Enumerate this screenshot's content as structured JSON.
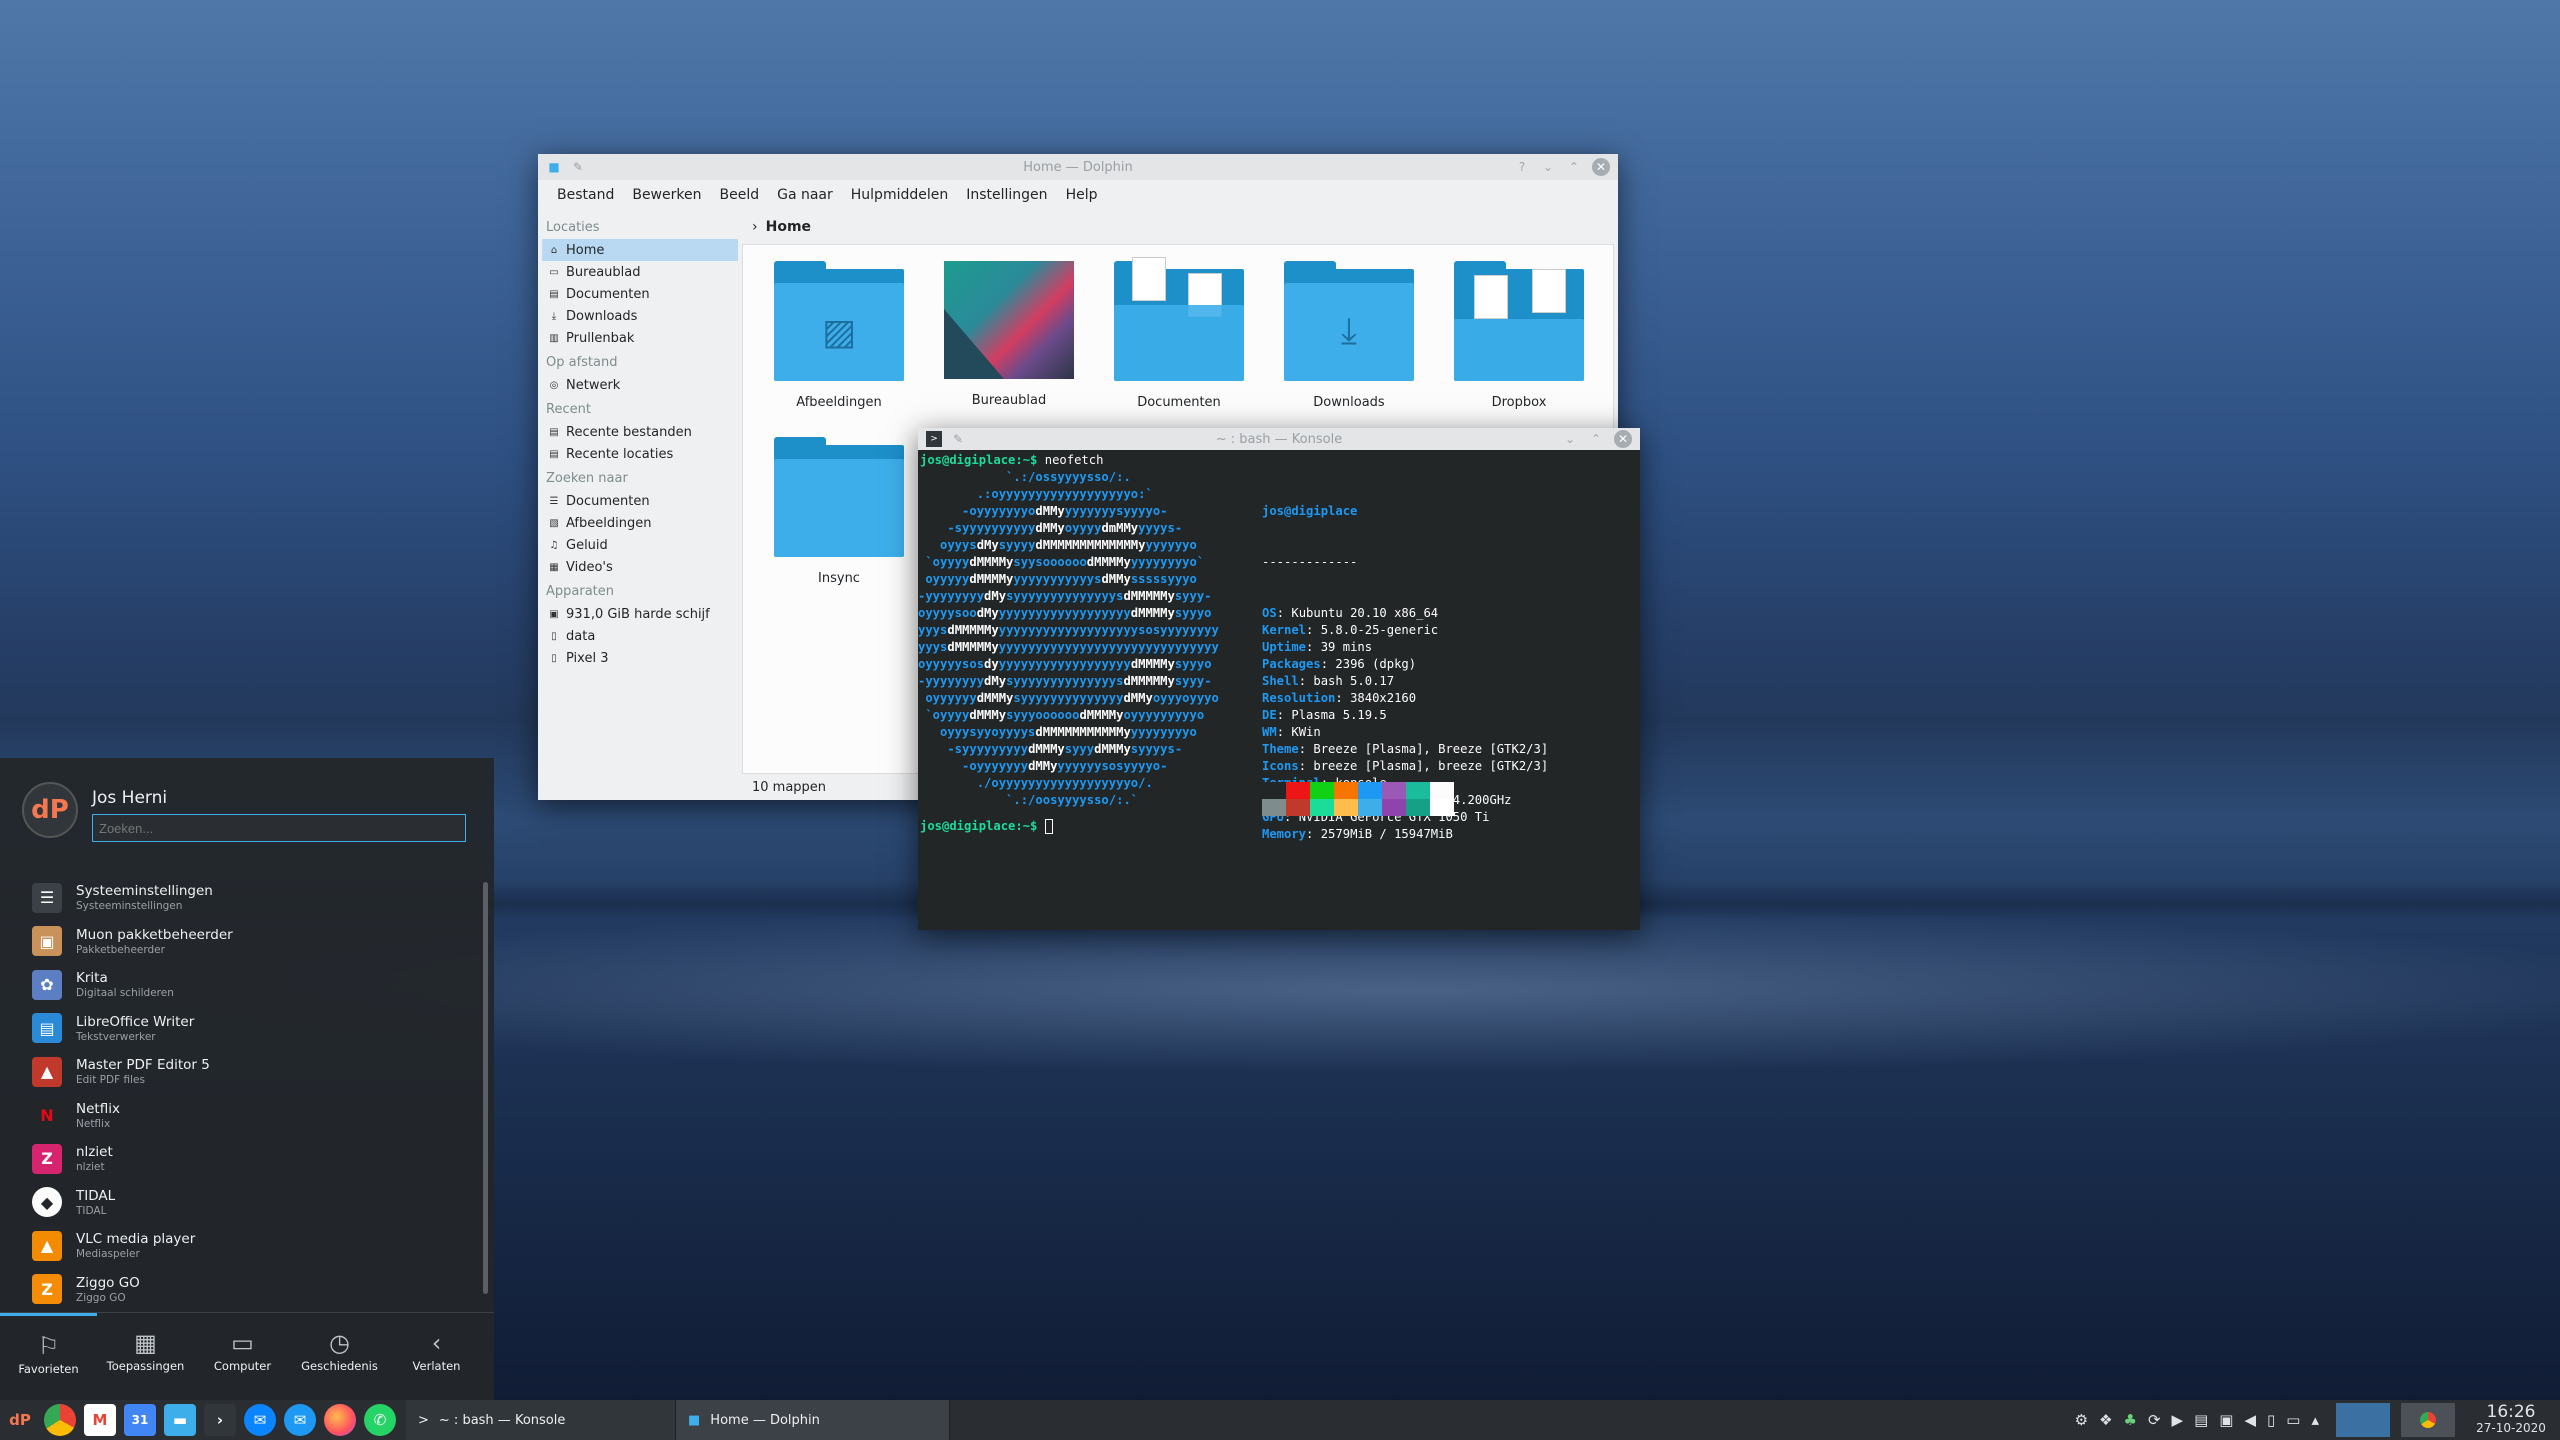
{
  "dolphin": {
    "title": "Home — Dolphin",
    "menu": [
      "Bestand",
      "Bewerken",
      "Beeld",
      "Ga naar",
      "Hulpmiddelen",
      "Instellingen",
      "Help"
    ],
    "sections": [
      {
        "header": "Locaties",
        "items": [
          "Home",
          "Bureaublad",
          "Documenten",
          "Downloads",
          "Prullenbak"
        ]
      },
      {
        "header": "Op afstand",
        "items": [
          "Netwerk"
        ]
      },
      {
        "header": "Recent",
        "items": [
          "Recente bestanden",
          "Recente locaties"
        ]
      },
      {
        "header": "Zoeken naar",
        "items": [
          "Documenten",
          "Afbeeldingen",
          "Geluid",
          "Video's"
        ]
      },
      {
        "header": "Apparaten",
        "items": [
          "931,0 GiB harde schijf",
          "data",
          "Pixel 3"
        ]
      }
    ],
    "breadcrumb": "Home",
    "files": [
      "Afbeeldingen",
      "Bureaublad",
      "Documenten",
      "Downloads",
      "Dropbox",
      "Insync"
    ],
    "status": "10 mappen"
  },
  "konsole": {
    "title": "~ : bash — Konsole",
    "prompt": "jos@digiplace:~$",
    "command": "neofetch",
    "logo_lines": [
      "            `.:/ossyyyysso/:.",
      "        .:oyyyyyyyyyyyyyyyyyyo:`",
      "      -oyyyyyyyo[w]dMMy[/w]yyyyyyysyyyyo-",
      "    -syyyyyyyyyy[w]dMMy[/w]oyyyy[w]dmMMy[/w]yyyys-",
      "   oyyys[w]dMy[/w]syyyy[w]dMMMMMMMMMMMMMy[/w]yyyyyyo",
      " `oyyyy[w]dMMMMy[/w]syysoooooo[w]dMMMMy[/w]yyyyyyyyo`",
      " oyyyyy[w]dMMMMy[/w]yyyyyyyyyyys[w]dMMy[/w]sssssyyyo",
      "-yyyyyyyy[w]dMy[/w]syyyyyyyyyyyyyys[w]dMMMMMy[/w]syyy-",
      "oyyyysoo[w]dMy[/w]yyyyyyyyyyyyyyyyyy[w]dMMMMy[/w]syyyo",
      "yyys[w]dMMMMMy[/w]yyyyyyyyyyyyyyyyyyysosyyyyyyyy",
      "yyys[w]dMMMMMy[/w]yyyyyyyyyyyyyyyyyyyyyyyyyyyyyy",
      "oyyyyysos[w]dy[/w]yyyyyyyyyyyyyyyyyy[w]dMMMMy[/w]syyyo",
      "-yyyyyyyy[w]dMy[/w]syyyyyyyyyyyyyys[w]dMMMMMy[/w]syyy-",
      " oyyyyyy[w]dMMMy[/w]syyyyyyyyyyyyyy[w]dMMy[/w]oyyyoyyyo",
      " `oyyyy[w]dMMMy[/w]syyyoooooo[w]dMMMMy[/w]oyyyyyyyyyo",
      "   oyyysyyoyyyys[w]dMMMMMMMMMMMy[/w]yyyyyyyyo",
      "    -syyyyyyyyy[w]dMMMy[/w]syyy[w]dMMMy[/w]syyyys-",
      "      -oyyyyyyy[w]dMMy[/w]yyyyyysosyyyyo-",
      "        ./oyyyyyyyyyyyyyyyyyyo/.",
      "            `.:/oosyyyysso/:.`"
    ],
    "user_host": "jos@digiplace",
    "separator": "-------------",
    "info": [
      {
        "key": "OS",
        "value": "Kubuntu 20.10 x86_64"
      },
      {
        "key": "Kernel",
        "value": "5.8.0-25-generic"
      },
      {
        "key": "Uptime",
        "value": "39 mins"
      },
      {
        "key": "Packages",
        "value": "2396 (dpkg)"
      },
      {
        "key": "Shell",
        "value": "bash 5.0.17"
      },
      {
        "key": "Resolution",
        "value": "3840x2160"
      },
      {
        "key": "DE",
        "value": "Plasma 5.19.5"
      },
      {
        "key": "WM",
        "value": "KWin"
      },
      {
        "key": "Theme",
        "value": "Breeze [Plasma], Breeze [GTK2/3]"
      },
      {
        "key": "Icons",
        "value": "breeze [Plasma], breeze [GTK2/3]"
      },
      {
        "key": "Terminal",
        "value": "konsole"
      },
      {
        "key": "CPU",
        "value": "Intel i7-6700K (8) @ 4.200GHz"
      },
      {
        "key": "GPU",
        "value": "NVIDIA GeForce GTX 1050 Ti"
      },
      {
        "key": "Memory",
        "value": "2579MiB / 15947MiB"
      }
    ],
    "palette_top": [
      "#232627",
      "#ed1515",
      "#11d116",
      "#f67400",
      "#1d99f3",
      "#9b59b6",
      "#1abc9c",
      "#fcfcfc"
    ],
    "palette_bottom": [
      "#7f8c8d",
      "#c0392b",
      "#1cdc9a",
      "#fdbc4b",
      "#3daee9",
      "#8e44ad",
      "#16a085",
      "#ffffff"
    ]
  },
  "launcher": {
    "user": "Jos Herni",
    "avatar_text": "dP",
    "search_placeholder": "Zoeken...",
    "apps": [
      {
        "name": "Systeeminstellingen",
        "desc": "Systeeminstellingen",
        "icon": "settings-icon",
        "color": "#3b4147",
        "glyph": "☰"
      },
      {
        "name": "Muon pakketbeheerder",
        "desc": "Pakketbeheerder",
        "icon": "package-icon",
        "color": "#c9925b",
        "glyph": "▣"
      },
      {
        "name": "Krita",
        "desc": "Digitaal schilderen",
        "icon": "krita-icon",
        "color": "#5c7fc4",
        "glyph": "✿"
      },
      {
        "name": "LibreOffice Writer",
        "desc": "Tekstverwerker",
        "icon": "writer-icon",
        "color": "#2a8ad8",
        "glyph": "▤"
      },
      {
        "name": "Master PDF Editor 5",
        "desc": "Edit PDF files",
        "icon": "pdf-icon",
        "color": "#c0392b",
        "glyph": "▲"
      },
      {
        "name": "Netflix",
        "desc": "Netflix",
        "icon": "netflix-icon",
        "color": "#232629",
        "glyph": "N"
      },
      {
        "name": "nlziet",
        "desc": "nlziet",
        "icon": "nlziet-icon",
        "color": "#d6246e",
        "glyph": "Z"
      },
      {
        "name": "TIDAL",
        "desc": "TIDAL",
        "icon": "tidal-icon",
        "color": "#fcfcfc",
        "glyph": "◆"
      },
      {
        "name": "VLC media player",
        "desc": "Mediaspeler",
        "icon": "vlc-icon",
        "color": "#f28b00",
        "glyph": "▲"
      },
      {
        "name": "Ziggo GO",
        "desc": "Ziggo GO",
        "icon": "ziggo-icon",
        "color": "#f48c06",
        "glyph": "Z"
      }
    ],
    "tabs": [
      {
        "label": "Favorieten",
        "icon": "bookmark-icon",
        "glyph": "⚐"
      },
      {
        "label": "Toepassingen",
        "icon": "grid-icon",
        "glyph": "▦"
      },
      {
        "label": "Computer",
        "icon": "monitor-icon",
        "glyph": "▭"
      },
      {
        "label": "Geschiedenis",
        "icon": "clock-icon",
        "glyph": "◷"
      },
      {
        "label": "Verlaten",
        "icon": "leave-icon",
        "glyph": "‹"
      }
    ]
  },
  "taskbar": {
    "tasks": [
      "~ : bash — Konsole",
      "Home — Dolphin"
    ],
    "time": "16:26",
    "date": "27-10-2020"
  }
}
